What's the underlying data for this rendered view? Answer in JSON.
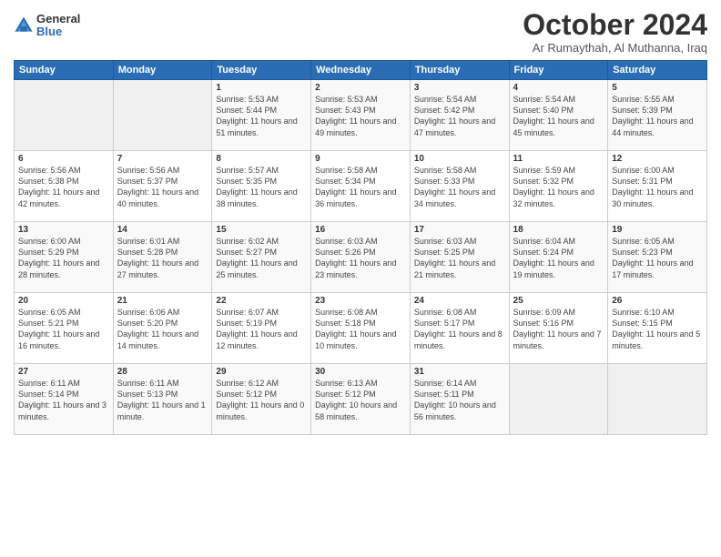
{
  "logo": {
    "general": "General",
    "blue": "Blue"
  },
  "header": {
    "month": "October 2024",
    "location": "Ar Rumaythah, Al Muthanna, Iraq"
  },
  "days_of_week": [
    "Sunday",
    "Monday",
    "Tuesday",
    "Wednesday",
    "Thursday",
    "Friday",
    "Saturday"
  ],
  "weeks": [
    [
      {
        "day": "",
        "empty": true
      },
      {
        "day": "",
        "empty": true
      },
      {
        "day": "1",
        "sunrise": "5:53 AM",
        "sunset": "5:44 PM",
        "daylight": "11 hours and 51 minutes."
      },
      {
        "day": "2",
        "sunrise": "5:53 AM",
        "sunset": "5:43 PM",
        "daylight": "11 hours and 49 minutes."
      },
      {
        "day": "3",
        "sunrise": "5:54 AM",
        "sunset": "5:42 PM",
        "daylight": "11 hours and 47 minutes."
      },
      {
        "day": "4",
        "sunrise": "5:54 AM",
        "sunset": "5:40 PM",
        "daylight": "11 hours and 45 minutes."
      },
      {
        "day": "5",
        "sunrise": "5:55 AM",
        "sunset": "5:39 PM",
        "daylight": "11 hours and 44 minutes."
      }
    ],
    [
      {
        "day": "6",
        "sunrise": "5:56 AM",
        "sunset": "5:38 PM",
        "daylight": "11 hours and 42 minutes."
      },
      {
        "day": "7",
        "sunrise": "5:56 AM",
        "sunset": "5:37 PM",
        "daylight": "11 hours and 40 minutes."
      },
      {
        "day": "8",
        "sunrise": "5:57 AM",
        "sunset": "5:35 PM",
        "daylight": "11 hours and 38 minutes."
      },
      {
        "day": "9",
        "sunrise": "5:58 AM",
        "sunset": "5:34 PM",
        "daylight": "11 hours and 36 minutes."
      },
      {
        "day": "10",
        "sunrise": "5:58 AM",
        "sunset": "5:33 PM",
        "daylight": "11 hours and 34 minutes."
      },
      {
        "day": "11",
        "sunrise": "5:59 AM",
        "sunset": "5:32 PM",
        "daylight": "11 hours and 32 minutes."
      },
      {
        "day": "12",
        "sunrise": "6:00 AM",
        "sunset": "5:31 PM",
        "daylight": "11 hours and 30 minutes."
      }
    ],
    [
      {
        "day": "13",
        "sunrise": "6:00 AM",
        "sunset": "5:29 PM",
        "daylight": "11 hours and 28 minutes."
      },
      {
        "day": "14",
        "sunrise": "6:01 AM",
        "sunset": "5:28 PM",
        "daylight": "11 hours and 27 minutes."
      },
      {
        "day": "15",
        "sunrise": "6:02 AM",
        "sunset": "5:27 PM",
        "daylight": "11 hours and 25 minutes."
      },
      {
        "day": "16",
        "sunrise": "6:03 AM",
        "sunset": "5:26 PM",
        "daylight": "11 hours and 23 minutes."
      },
      {
        "day": "17",
        "sunrise": "6:03 AM",
        "sunset": "5:25 PM",
        "daylight": "11 hours and 21 minutes."
      },
      {
        "day": "18",
        "sunrise": "6:04 AM",
        "sunset": "5:24 PM",
        "daylight": "11 hours and 19 minutes."
      },
      {
        "day": "19",
        "sunrise": "6:05 AM",
        "sunset": "5:23 PM",
        "daylight": "11 hours and 17 minutes."
      }
    ],
    [
      {
        "day": "20",
        "sunrise": "6:05 AM",
        "sunset": "5:21 PM",
        "daylight": "11 hours and 16 minutes."
      },
      {
        "day": "21",
        "sunrise": "6:06 AM",
        "sunset": "5:20 PM",
        "daylight": "11 hours and 14 minutes."
      },
      {
        "day": "22",
        "sunrise": "6:07 AM",
        "sunset": "5:19 PM",
        "daylight": "11 hours and 12 minutes."
      },
      {
        "day": "23",
        "sunrise": "6:08 AM",
        "sunset": "5:18 PM",
        "daylight": "11 hours and 10 minutes."
      },
      {
        "day": "24",
        "sunrise": "6:08 AM",
        "sunset": "5:17 PM",
        "daylight": "11 hours and 8 minutes."
      },
      {
        "day": "25",
        "sunrise": "6:09 AM",
        "sunset": "5:16 PM",
        "daylight": "11 hours and 7 minutes."
      },
      {
        "day": "26",
        "sunrise": "6:10 AM",
        "sunset": "5:15 PM",
        "daylight": "11 hours and 5 minutes."
      }
    ],
    [
      {
        "day": "27",
        "sunrise": "6:11 AM",
        "sunset": "5:14 PM",
        "daylight": "11 hours and 3 minutes."
      },
      {
        "day": "28",
        "sunrise": "6:11 AM",
        "sunset": "5:13 PM",
        "daylight": "11 hours and 1 minute."
      },
      {
        "day": "29",
        "sunrise": "6:12 AM",
        "sunset": "5:12 PM",
        "daylight": "11 hours and 0 minutes."
      },
      {
        "day": "30",
        "sunrise": "6:13 AM",
        "sunset": "5:12 PM",
        "daylight": "10 hours and 58 minutes."
      },
      {
        "day": "31",
        "sunrise": "6:14 AM",
        "sunset": "5:11 PM",
        "daylight": "10 hours and 56 minutes."
      },
      {
        "day": "",
        "empty": true
      },
      {
        "day": "",
        "empty": true
      }
    ]
  ],
  "labels": {
    "sunrise_prefix": "Sunrise: ",
    "sunset_prefix": "Sunset: ",
    "daylight_prefix": "Daylight: "
  }
}
